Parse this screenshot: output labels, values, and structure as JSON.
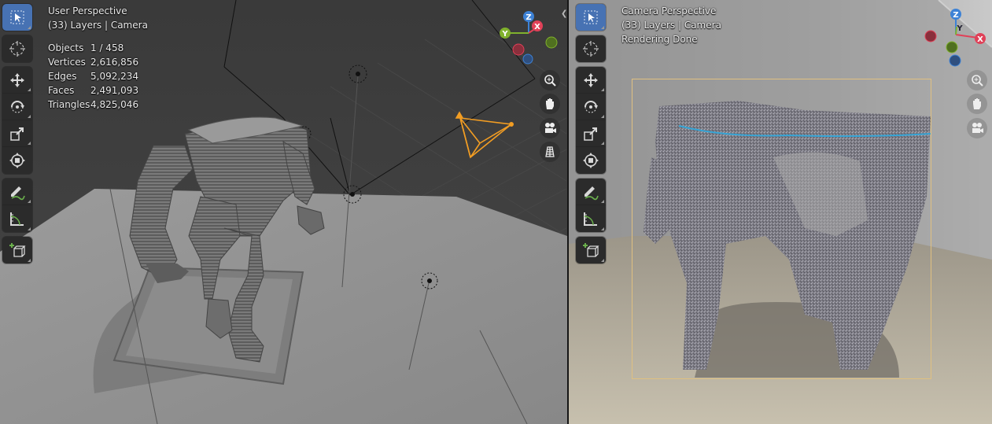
{
  "left_viewport": {
    "title": "User Perspective",
    "subtitle": "(33) Layers | Camera",
    "stats": [
      {
        "label": "Objects",
        "value": "1 / 458"
      },
      {
        "label": "Vertices",
        "value": "2,616,856"
      },
      {
        "label": "Edges",
        "value": "5,092,234"
      },
      {
        "label": "Faces",
        "value": "2,491,093"
      },
      {
        "label": "Triangles",
        "value": "4,825,046"
      }
    ],
    "gizmo": {
      "x": "X",
      "y": "Y",
      "z": "Z"
    }
  },
  "right_viewport": {
    "title": "Camera Perspective",
    "subtitle": "(33) Layers | Camera",
    "status": "Rendering Done",
    "gizmo": {
      "x": "X",
      "y": "Y",
      "z": "Z"
    }
  },
  "colors": {
    "accent": "#4772b3",
    "axis_x": "#e04158",
    "axis_y": "#80b12d",
    "axis_z": "#3d82d6",
    "camera_selected": "#f29d23",
    "render_border": "#e0c080",
    "ice_trace": "#36a5d6"
  },
  "toolbar_tools": [
    "select-box-icon",
    "cursor-icon",
    "move-icon",
    "rotate-icon",
    "scale-icon",
    "transform-icon",
    "annotate-icon",
    "measure-icon",
    "add-cube-icon"
  ],
  "nav_buttons": [
    "zoom-icon",
    "hand-pan-icon",
    "camera-view-icon",
    "grid-ortho-icon"
  ]
}
